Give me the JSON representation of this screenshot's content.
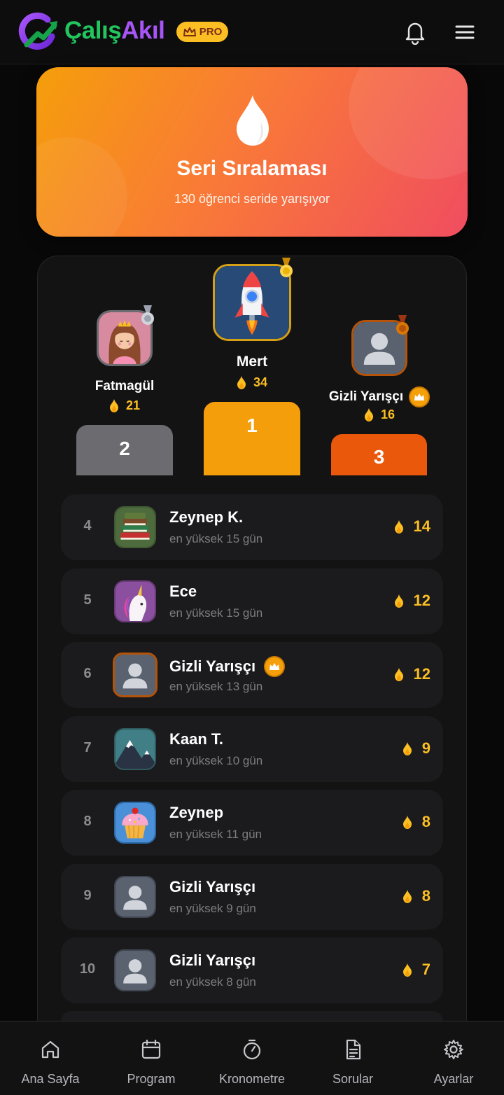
{
  "header": {
    "logo_part1": "Çalış",
    "logo_part2": "Akıl",
    "pro_badge": "PRO"
  },
  "hero": {
    "title": "Seri Sıralaması",
    "subtitle": "130 öğrenci seride yarışıyor"
  },
  "podium": {
    "first": {
      "rank": "1",
      "name": "Mert",
      "score": "34",
      "avatar": "rocket",
      "medal": "gold"
    },
    "second": {
      "rank": "2",
      "name": "Fatmagül",
      "score": "21",
      "avatar": "princess",
      "medal": "silver"
    },
    "third": {
      "rank": "3",
      "name": "Gizli Yarışçı",
      "score": "16",
      "avatar": "anonymous",
      "medal": "bronze",
      "pro": true
    }
  },
  "leaderboard": [
    {
      "rank": "4",
      "name": "Zeynep K.",
      "best": "en yüksek 15 gün",
      "score": "14",
      "avatar": "books"
    },
    {
      "rank": "5",
      "name": "Ece",
      "best": "en yüksek 15 gün",
      "score": "12",
      "avatar": "unicorn"
    },
    {
      "rank": "6",
      "name": "Gizli Yarışçı",
      "best": "en yüksek 13 gün",
      "score": "12",
      "avatar": "anonymous",
      "pro": true
    },
    {
      "rank": "7",
      "name": "Kaan T.",
      "best": "en yüksek 10 gün",
      "score": "9",
      "avatar": "mountain"
    },
    {
      "rank": "8",
      "name": "Zeynep",
      "best": "en yüksek 11 gün",
      "score": "8",
      "avatar": "cupcake"
    },
    {
      "rank": "9",
      "name": "Gizli Yarışçı",
      "best": "en yüksek 9 gün",
      "score": "8",
      "avatar": "anonymous"
    },
    {
      "rank": "10",
      "name": "Gizli Yarışçı",
      "best": "en yüksek 8 gün",
      "score": "7",
      "avatar": "anonymous"
    }
  ],
  "nav": [
    {
      "label": "Ana Sayfa",
      "icon": "home-icon"
    },
    {
      "label": "Program",
      "icon": "calendar-icon"
    },
    {
      "label": "Kronometre",
      "icon": "stopwatch-icon"
    },
    {
      "label": "Sorular",
      "icon": "document-icon"
    },
    {
      "label": "Ayarlar",
      "icon": "gear-icon"
    }
  ],
  "colors": {
    "gold": "#f59e0b",
    "silver": "#6b6b70",
    "bronze": "#ea580c",
    "score": "#fbbf24",
    "brand_green": "#22c55e",
    "brand_purple": "#a855f7"
  }
}
